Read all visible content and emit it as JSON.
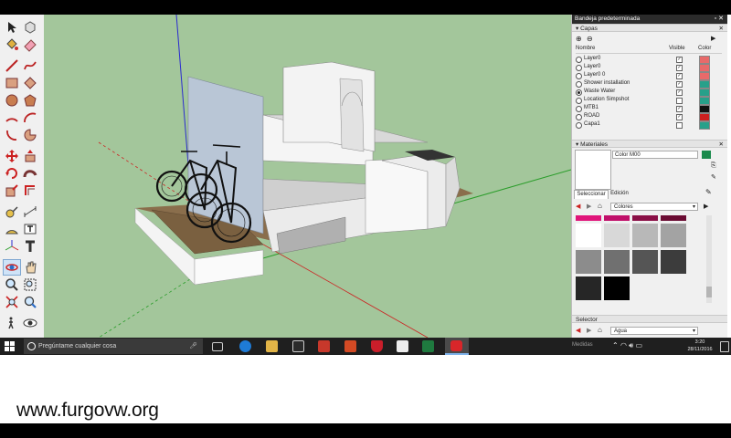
{
  "tray": {
    "title": "Bandeja predeterminada",
    "title_controls": "▫ ✕",
    "layers": {
      "header": "Capas",
      "col_name": "Nombre",
      "col_visible": "Visible",
      "col_color": "Color",
      "items": [
        {
          "name": "Layer0",
          "visible": true,
          "active": false,
          "color": "#e86a6a"
        },
        {
          "name": "Layer0",
          "visible": true,
          "active": false,
          "color": "#e86a6a"
        },
        {
          "name": "Layer0 0",
          "visible": true,
          "active": false,
          "color": "#e86a6a"
        },
        {
          "name": "Shower installation",
          "visible": true,
          "active": false,
          "color": "#27a08a"
        },
        {
          "name": "Waste Water",
          "visible": true,
          "active": true,
          "color": "#27a08a"
        },
        {
          "name": "Location Simpshot",
          "visible": false,
          "active": false,
          "color": "#27a08a"
        },
        {
          "name": "MTB1",
          "visible": true,
          "active": false,
          "color": "#111111"
        },
        {
          "name": "ROAD",
          "visible": true,
          "active": false,
          "color": "#cc1f1f"
        },
        {
          "name": "Capa1",
          "visible": false,
          "active": false,
          "color": "#27a08a"
        }
      ]
    },
    "materials": {
      "header": "Materiales",
      "current": "Color M00",
      "tab_select": "Seleccionar",
      "tab_edit": "Edición",
      "library": "Colores",
      "swatches": [
        "#ffffff",
        "#d8d8d8",
        "#b8b8b8",
        "#a3a3a3",
        "#8c8c8c",
        "#707070",
        "#555555",
        "#3c3c3c",
        "#262626",
        "#000000"
      ]
    },
    "selector": {
      "header": "Selector",
      "library": "Agua"
    }
  },
  "taskbar": {
    "search_placeholder": "Pregúntame cualquier cosa",
    "behind_status": "Medidas",
    "time": "3:20",
    "date": "28/11/2016"
  },
  "watermark": "www.furgovw.org"
}
